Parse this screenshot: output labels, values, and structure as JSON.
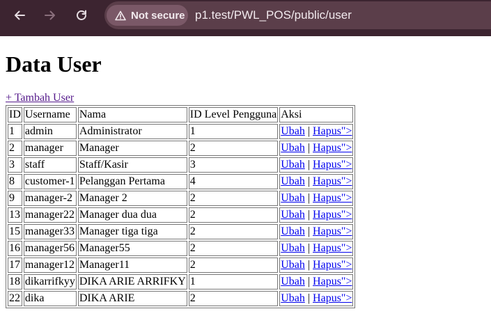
{
  "browser": {
    "security_label": "Not secure",
    "url": "p1.test/PWL_POS/public/user"
  },
  "page": {
    "title": "Data User",
    "add_link": "+ Tambah User"
  },
  "table": {
    "headers": [
      "ID",
      "Username",
      "Nama",
      "ID Level Pengguna",
      "Aksi"
    ],
    "rows": [
      {
        "id": "1",
        "username": "admin",
        "nama": "Administrator",
        "level": "1"
      },
      {
        "id": "2",
        "username": "manager",
        "nama": "Manager",
        "level": "2"
      },
      {
        "id": "3",
        "username": "staff",
        "nama": "Staff/Kasir",
        "level": "3"
      },
      {
        "id": "8",
        "username": "customer-1",
        "nama": "Pelanggan Pertama",
        "level": "4"
      },
      {
        "id": "9",
        "username": "manager-2",
        "nama": "Manager 2",
        "level": "2"
      },
      {
        "id": "13",
        "username": "manager22",
        "nama": "Manager dua dua",
        "level": "2"
      },
      {
        "id": "15",
        "username": "manager33",
        "nama": "Manager tiga tiga",
        "level": "2"
      },
      {
        "id": "16",
        "username": "manager56",
        "nama": "Manager55",
        "level": "2"
      },
      {
        "id": "17",
        "username": "manager12",
        "nama": "Manager11",
        "level": "2"
      },
      {
        "id": "18",
        "username": "dikarrifkyy",
        "nama": "DIKA ARIE ARRIFKY",
        "level": "1"
      },
      {
        "id": "22",
        "username": "dika",
        "nama": "DIKA ARIE",
        "level": "2"
      }
    ],
    "actions": {
      "edit": "Ubah",
      "separator": "|",
      "delete": "Hapus\">"
    }
  }
}
